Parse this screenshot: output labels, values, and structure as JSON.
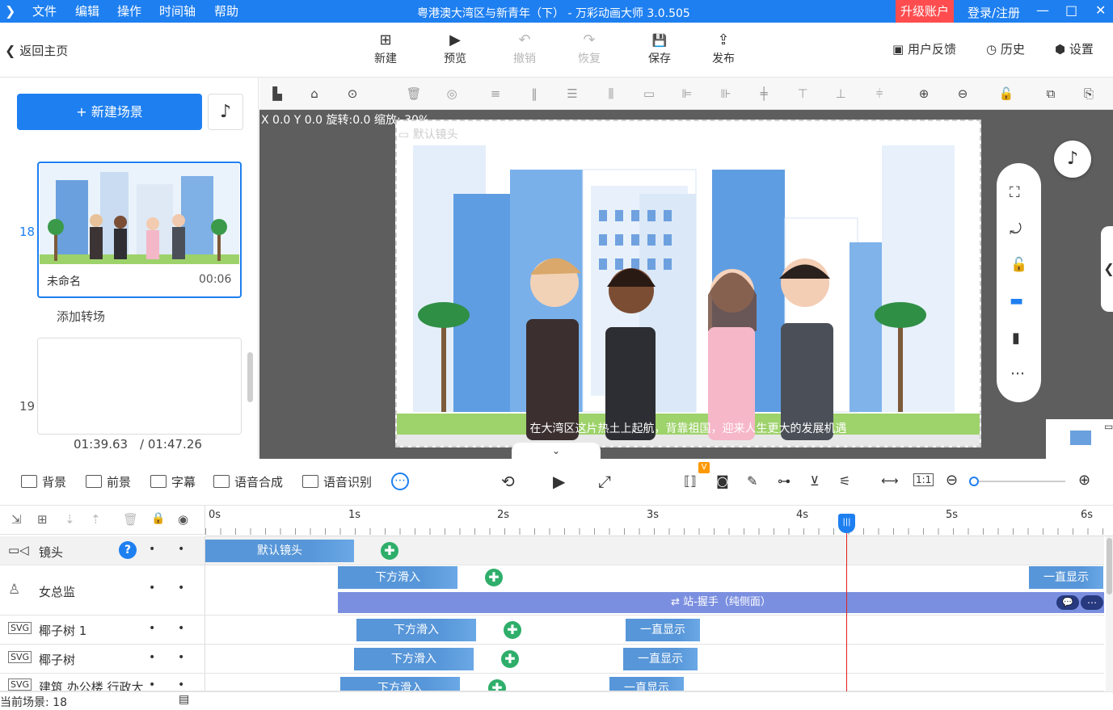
{
  "titlebar": {
    "menus": [
      "文件",
      "编辑",
      "操作",
      "时间轴",
      "帮助"
    ],
    "title": "粤港澳大湾区与新青年（下） - 万彩动画大师 3.0.505",
    "upgrade": "升级账户",
    "login": "登录/注册",
    "minimize": "—",
    "maximize": "□",
    "close": "✕"
  },
  "toolbar": {
    "back": "返回主页",
    "buttons": [
      {
        "label": "新建",
        "icon": "⊞"
      },
      {
        "label": "预览",
        "icon": "▶"
      },
      {
        "label": "撤销",
        "icon": "↶"
      },
      {
        "label": "恢复",
        "icon": "↷"
      },
      {
        "label": "保存",
        "icon": "💾"
      },
      {
        "label": "发布",
        "icon": "⇪"
      }
    ],
    "feedback": "用户反馈",
    "history": "历史",
    "settings": "设置"
  },
  "scenes": {
    "new_scene": "+ 新建场景",
    "scene18_number": "18",
    "scene18_name": "未命名",
    "scene18_duration": "00:06",
    "add_transition": "添加转场",
    "scene19_number": "19",
    "current_time": "01:39.63",
    "total_time": "/ 01:47.26"
  },
  "canvas": {
    "coords": "X 0.0 Y 0.0 旋转:0.0 缩放: 30%",
    "camera_label": "默认镜头",
    "subtitle": "在大湾区这片热土上起航，背靠祖国，迎来人生更大的发展机遇"
  },
  "timeline_tools": {
    "background": "背景",
    "foreground": "前景",
    "caption": "字幕",
    "tts": "语音合成",
    "asr": "语音识别",
    "badge": "V"
  },
  "ruler": [
    "0s",
    "1s",
    "2s",
    "3s",
    "4s",
    "5s",
    "6s"
  ],
  "tracks": [
    {
      "name": "镜头",
      "clips": [
        {
          "label": "默认镜头"
        }
      ]
    },
    {
      "name": "女总监",
      "clips": [
        {
          "label": "下方滑入"
        },
        {
          "label": "一直显示"
        }
      ],
      "action": "⇄ 站-握手（纯侧面）"
    },
    {
      "name": "椰子树 1",
      "clips": [
        {
          "label": "下方滑入"
        },
        {
          "label": "一直显示"
        }
      ]
    },
    {
      "name": "椰子树",
      "clips": [
        {
          "label": "下方滑入"
        },
        {
          "label": "一直显示"
        }
      ]
    },
    {
      "name": "建筑 办公楼 行政大楼",
      "clips": [
        {
          "label": "下方滑入"
        },
        {
          "label": "一直显示"
        }
      ]
    }
  ],
  "status": {
    "current_scene": "当前场景: 18"
  }
}
